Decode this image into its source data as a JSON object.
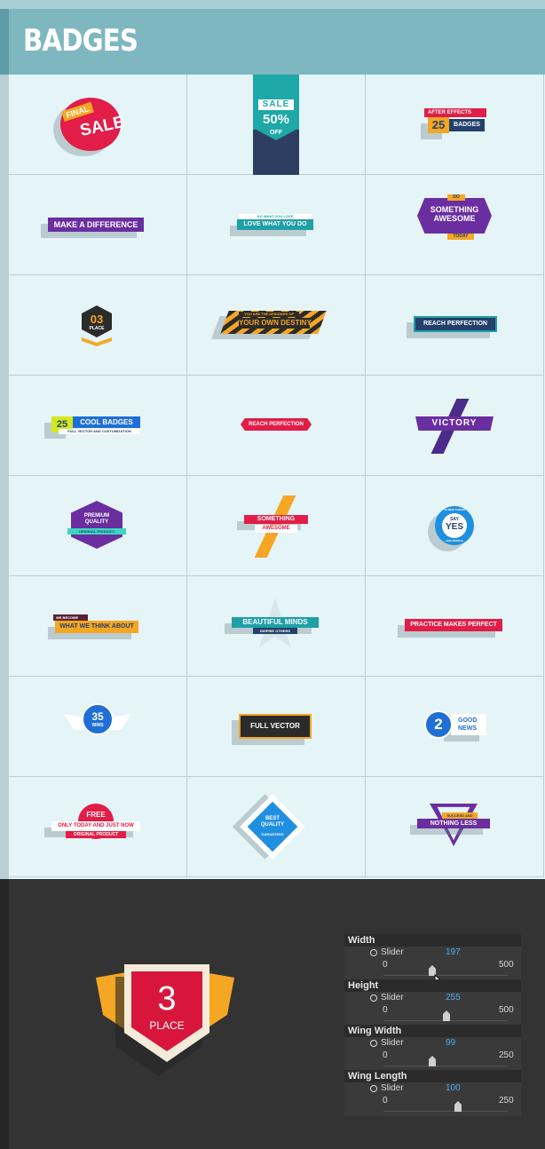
{
  "header": {
    "title": "BADGES"
  },
  "badges": {
    "r1c1": {
      "top": "FINAL",
      "main": "SALE"
    },
    "r1c2": {
      "top": "SALE",
      "percent": "50%",
      "sub": "OFF"
    },
    "r1c3": {
      "top": "AFTER EFFECTS",
      "number": "25",
      "label": "BADGES"
    },
    "r2c1": {
      "label": "MAKE A DIFFERENCE"
    },
    "r2c2": {
      "small": "DO WHAT YOU LOVE",
      "label": "LOVE WHAT YOU DO"
    },
    "r2c3": {
      "top": "DO",
      "line1": "SOMETHING",
      "line2": "AWESOME",
      "sub": "TODAY"
    },
    "r3c1": {
      "number": "03",
      "label": "PLACE"
    },
    "r3c2": {
      "small": "YOU ARE THE DESIGNER OF",
      "label": "YOUR OWN DESTINY"
    },
    "r3c3": {
      "label": "REACH PERFECTION"
    },
    "r4c1": {
      "number": "25",
      "label": "COOL BADGES",
      "sub": "FULL VECTOR AND CUSTOMIZATION"
    },
    "r4c2": {
      "label": "REACH PERFECTION"
    },
    "r4c3": {
      "label": "VICTORY"
    },
    "r5c1": {
      "line1": "PREMIUM",
      "line2": "QUALITY",
      "sub": "ORIGINAL PRODUCT"
    },
    "r5c2": {
      "line1": "SOMETHING",
      "line2": "AWESOME"
    },
    "r5c3": {
      "ring_top": "TO NEW THINGS",
      "line1": "SAY",
      "line2": "YES",
      "ring_bottom": "AND PEOPLE"
    },
    "r6c1": {
      "small": "WE BECOME",
      "label": "WHAT WE THINK ABOUT"
    },
    "r6c2": {
      "label": "BEAUTIFUL MINDS",
      "sub": "INSPIRE OTHERS"
    },
    "r6c3": {
      "label": "PRACTICE MAKES PERFECT"
    },
    "r7c1": {
      "number": "35",
      "label": "WINS"
    },
    "r7c2": {
      "label": "FULL VECTOR"
    },
    "r7c3": {
      "number": "2",
      "line1": "GOOD",
      "line2": "NEWS"
    },
    "r8c1": {
      "top": "FREE",
      "label": "ONLY TODAY AND JUST NOW",
      "sub": "ORIGINAL PRODUCT"
    },
    "r8c2": {
      "line1": "BEST",
      "line2": "QUALITY",
      "sub": "GARANTEED"
    },
    "r8c3": {
      "top": "SUCCESS AND",
      "label": "NOTHING LESS"
    }
  },
  "preview": {
    "number": "3",
    "label": "PLACE"
  },
  "controls": [
    {
      "name": "Width",
      "slider_label": "Slider",
      "value": "197",
      "min": "0",
      "max": "500",
      "fraction": 0.394
    },
    {
      "name": "Height",
      "slider_label": "Slider",
      "value": "255",
      "min": "0",
      "max": "500",
      "fraction": 0.51
    },
    {
      "name": "Wing Width",
      "slider_label": "Slider",
      "value": "99",
      "min": "0",
      "max": "250",
      "fraction": 0.396
    },
    {
      "name": "Wing Length",
      "slider_label": "Slider",
      "value": "100",
      "min": "0",
      "max": "250",
      "fraction": 0.6
    }
  ],
  "colors": {
    "header": "#7fb7c1",
    "grid_bg": "#e4f4f7",
    "panel": "#333333",
    "value_blue": "#4aaef0",
    "red": "#e11d48",
    "purple": "#6a2ea0",
    "teal": "#1f9fa6",
    "navy": "#24406b",
    "orange": "#f5a623"
  }
}
